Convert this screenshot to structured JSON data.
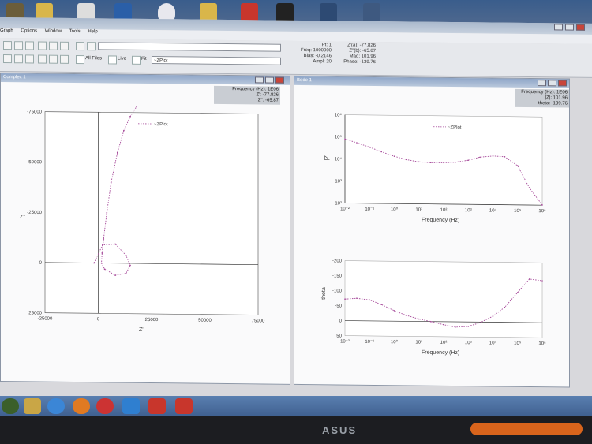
{
  "menu": [
    "Graph",
    "Options",
    "Window",
    "Tools",
    "Help"
  ],
  "toolbar": {
    "all_files_label": "All Files",
    "live_label": "Live",
    "fit_label": "Fit",
    "plot_combo_value": "~ZPlot"
  },
  "status": {
    "pt": "Pt: 1",
    "freq": "Freq: 1000000",
    "bias": "Bias: -0.2146",
    "ampl": "Ampl: 20",
    "za": "Z'(a): -77.826",
    "zb": "Z''(b): -65.87",
    "mag": "Mag: 101.96",
    "phase": "Phase: -139.76"
  },
  "left_pane": {
    "title": "Complex 1",
    "readout": [
      "Frequency (Hz): 1E06",
      "Z': -77.826",
      "Z'': -65.87"
    ]
  },
  "right_pane": {
    "title": "Bode 1",
    "readout": [
      "Frequency (Hz): 1E06",
      "|Z|: 101.96",
      "theta: -139.76"
    ]
  },
  "chart_data": [
    {
      "type": "scatter",
      "title": "",
      "legend": "~ZPlot",
      "xlabel": "Z'",
      "ylabel": "Z''",
      "xlim": [
        -25000,
        75000
      ],
      "ylim": [
        -75000,
        25000
      ],
      "x_ticks": [
        "-25000",
        "0",
        "25000",
        "50000",
        "75000"
      ],
      "y_ticks": [
        "-75000",
        "-50000",
        "-25000",
        "0",
        "25000"
      ],
      "series": [
        {
          "name": "~ZPlot",
          "x": [
            -2000,
            2000,
            8000,
            13000,
            15000,
            13000,
            8000,
            3000,
            1500,
            1800,
            2500,
            4000,
            6000,
            9000,
            12000,
            15000,
            18000
          ],
          "y": [
            0,
            -9000,
            -9500,
            -4000,
            1000,
            5000,
            6000,
            3000,
            0,
            -5000,
            -12000,
            -25000,
            -40000,
            -55000,
            -66000,
            -73000,
            -78000
          ]
        }
      ]
    },
    {
      "type": "line",
      "legend": "~ZPlot",
      "xlabel": "Frequency (Hz)",
      "ylabel": "|Z|",
      "log_scale": true,
      "x_ticks": [
        "10⁻²",
        "10⁻¹",
        "10⁰",
        "10¹",
        "10²",
        "10³",
        "10⁴",
        "10⁵",
        "10⁶"
      ],
      "y_ticks": [
        "10⁶",
        "10⁵",
        "10⁴",
        "10³",
        "10²"
      ],
      "series": [
        {
          "name": "~ZPlot",
          "x": [
            0.01,
            0.03,
            0.1,
            0.3,
            1,
            3,
            10,
            30,
            100,
            300,
            1000,
            3000,
            10000,
            30000,
            100000,
            300000,
            1000000
          ],
          "y": [
            80000,
            55000,
            35000,
            22000,
            14000,
            10000,
            8000,
            7500,
            7500,
            8000,
            10000,
            14000,
            16000,
            15000,
            6000,
            600,
            102
          ]
        }
      ]
    },
    {
      "type": "line",
      "xlabel": "Frequency (Hz)",
      "ylabel": "theta",
      "log_scale_x": true,
      "ylim": [
        -200,
        50
      ],
      "x_ticks": [
        "10⁻²",
        "10⁻¹",
        "10⁰",
        "10¹",
        "10²",
        "10³",
        "10⁴",
        "10⁵",
        "10⁶"
      ],
      "y_ticks": [
        "-200",
        "-150",
        "-100",
        "-50",
        "0",
        "50"
      ],
      "series": [
        {
          "name": "~ZPlot",
          "x": [
            0.01,
            0.03,
            0.1,
            0.3,
            1,
            3,
            10,
            30,
            100,
            300,
            1000,
            3000,
            10000,
            30000,
            100000,
            300000,
            1000000
          ],
          "y": [
            -72,
            -75,
            -70,
            -55,
            -35,
            -20,
            -8,
            0,
            10,
            18,
            15,
            2,
            -20,
            -50,
            -100,
            -145,
            -140
          ]
        }
      ]
    }
  ],
  "colors": {
    "plot_line": "#a64a9a",
    "axis": "#555555"
  }
}
